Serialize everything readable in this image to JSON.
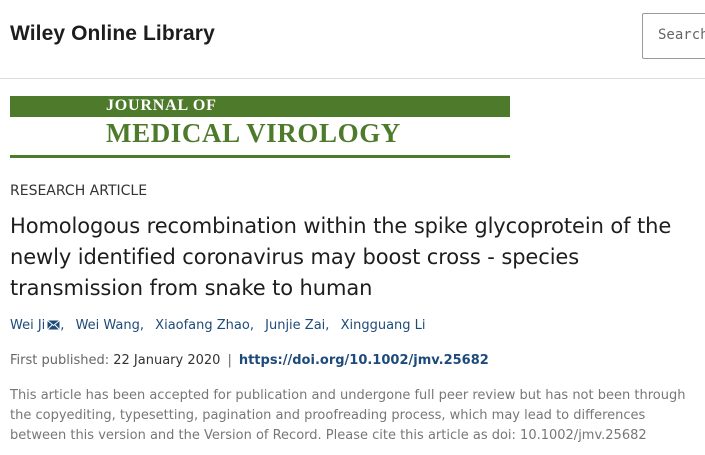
{
  "site": {
    "title": "Wiley Online Library"
  },
  "search": {
    "placeholder": "Search"
  },
  "journal": {
    "line1": "JOURNAL OF",
    "line2": "MEDICAL VIROLOGY",
    "color": "#4e7a2c"
  },
  "article": {
    "type": "RESEARCH ARTICLE",
    "title": "Homologous recombination within the spike glycoprotein of the newly identified coronavirus may boost cross - species transmission from snake to human",
    "authors": [
      "Wei Ji",
      "Wei Wang",
      "Xiaofang Zhao",
      "Junjie Zai",
      "Xingguang Li"
    ],
    "first_published_label": "First published:",
    "first_published_date": "22 January 2020",
    "doi": "https://doi.org/10.1002/jmv.25682",
    "notice": "This article has been accepted for publication and undergone full peer review but has not been through the copyediting, typesetting, pagination and proofreading process, which may lead to differences between this version and the Version of Record. Please cite this article as doi: 10.1002/jmv.25682"
  },
  "colors": {
    "link": "#1e4b7a",
    "brand_green": "#4e7a2c"
  },
  "icons": {
    "corresponding_author": "mail-icon"
  }
}
